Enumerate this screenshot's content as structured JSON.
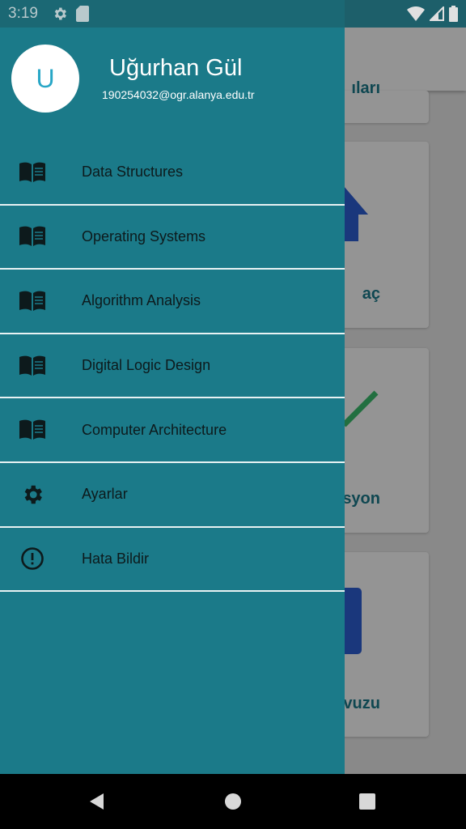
{
  "status_bar": {
    "time": "3:19",
    "left_icons": [
      "gear-icon",
      "sd-card-icon"
    ],
    "right_icons": [
      "wifi-icon",
      "signal-icon",
      "battery-icon"
    ]
  },
  "background": {
    "card_labels": [
      "ıları",
      "aç",
      "syon",
      "Kılavuzu"
    ]
  },
  "drawer": {
    "avatar_letter": "U",
    "user_name": "Uğurhan Gül",
    "user_email": "190254032@ogr.alanya.edu.tr",
    "items": [
      {
        "label": "Data Structures",
        "icon": "book-icon"
      },
      {
        "label": "Operating Systems",
        "icon": "book-icon"
      },
      {
        "label": "Algorithm Analysis",
        "icon": "book-icon"
      },
      {
        "label": "Digital Logic Design",
        "icon": "book-icon"
      },
      {
        "label": "Computer Architecture",
        "icon": "book-icon"
      },
      {
        "label": "Ayarlar",
        "icon": "gear-icon"
      },
      {
        "label": "Hata Bildir",
        "icon": "alert-circle-icon"
      }
    ]
  },
  "colors": {
    "drawer_bg": "#1b7a89",
    "avatar_text": "#27a6c6",
    "accent_text": "#1a7b8c"
  }
}
